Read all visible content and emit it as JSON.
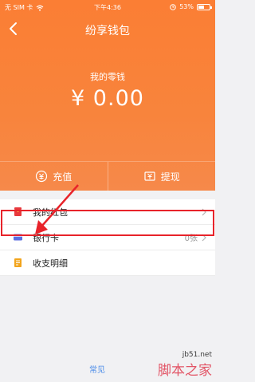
{
  "status_bar": {
    "carrier": "无 SIM 卡",
    "time": "下午4:36",
    "battery_percent": 0.53,
    "battery_label": "53%"
  },
  "header": {
    "title": "纷享钱包",
    "back_icon": "chevron-left-icon"
  },
  "wallet": {
    "balance_label": "我的零钱",
    "balance_amount": "¥ 0.00"
  },
  "actions": [
    {
      "label": "充值",
      "icon": "deposit-icon"
    },
    {
      "label": "提现",
      "icon": "withdraw-icon"
    }
  ],
  "menu": [
    {
      "label": "我的红包",
      "icon": "red-packet-icon",
      "value": "",
      "color": "#e8393d"
    },
    {
      "label": "银行卡",
      "icon": "bank-card-icon",
      "value": "0张",
      "color": "#5b6ee1"
    },
    {
      "label": "收支明细",
      "icon": "statement-icon",
      "value": "",
      "color": "#f2a41c"
    }
  ],
  "footer": {
    "faq_link": "常见"
  },
  "watermark": {
    "url": "jb51.net",
    "name": "脚本之家"
  },
  "colors": {
    "brand_orange": "#f8843c",
    "highlight_red": "#e8232a"
  }
}
